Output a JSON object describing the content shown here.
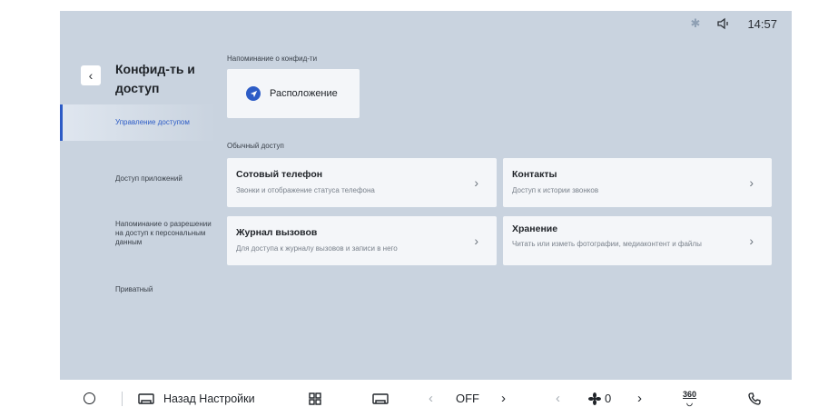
{
  "status": {
    "bluetooth_icon": "bluetooth-icon",
    "volume_icon": "volume-icon",
    "time": "14:57"
  },
  "sidebar": {
    "title": "Конфид-ть и доступ",
    "items": [
      {
        "label": "Управление доступом",
        "active": true
      },
      {
        "label": "Доступ приложений",
        "active": false
      },
      {
        "label": "Напоминание о разрешении на доступ к персональным данным",
        "active": false
      },
      {
        "label": "Приватный",
        "active": false
      }
    ]
  },
  "reminder": {
    "label": "Напоминание о конфид-ти",
    "location_label": "Расположение"
  },
  "common_access": {
    "label": "Обычный доступ",
    "cards": [
      {
        "title": "Сотовый телефон",
        "desc": "Звонки и отображение статуса телефона"
      },
      {
        "title": "Контакты",
        "desc": "Доступ к истории звонков"
      },
      {
        "title": "Журнал вызовов",
        "desc": "Для доступа к журналу вызовов и записи в него"
      },
      {
        "title": "Хранение",
        "desc": "Читать или изметь фотографии, медиаконтент и файлы"
      }
    ]
  },
  "bottombar": {
    "back_label": "Назад Настройки",
    "climate_value": "OFF",
    "fan_value": "0",
    "view_360": "360"
  }
}
